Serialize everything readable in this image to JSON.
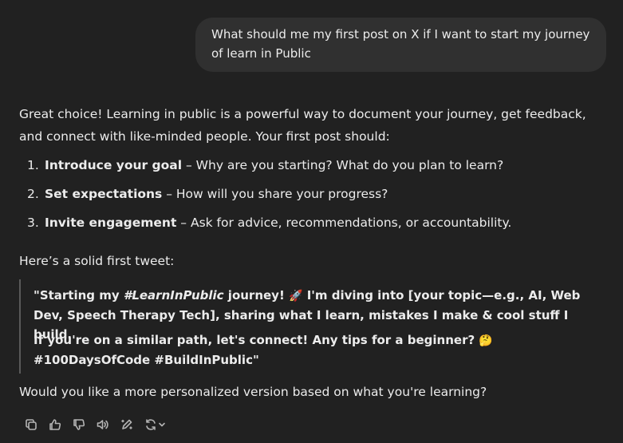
{
  "user_message": "What should me my first post on X if I want to start my journey of learn in Public",
  "response": {
    "intro": "Great choice! Learning in public is a powerful way to document your journey, get feedback, and connect with like-minded people. Your first post should:",
    "list": [
      {
        "num": "1.",
        "title": "Introduce your goal",
        "rest": " – Why are you starting? What do you plan to learn?"
      },
      {
        "num": "2.",
        "title": "Set expectations",
        "rest": " – How will you share your progress?"
      },
      {
        "num": "3.",
        "title": "Invite engagement",
        "rest": " – Ask for advice, recommendations, or accountability."
      }
    ],
    "tweet_intro": "Here’s a solid first tweet:",
    "quote": {
      "p1_a": "\"Starting my ",
      "p1_hashtag": "#LearnInPublic",
      "p1_b": " journey! ",
      "p1_emoji": "🚀",
      "p1_c": " I'm diving into [your topic—e.g., AI, Web Dev, Speech Therapy Tech], sharing what I learn, mistakes I make & cool stuff I build.",
      "p2_a": "If you're on a similar path, let's connect! Any tips for a beginner? ",
      "p2_emoji": "🤔",
      "p2_b": " #100DaysOfCode #BuildInPublic\""
    },
    "closing": "Would you like a more personalized version based on what you're learning?"
  },
  "actions": [
    {
      "name": "copy-icon"
    },
    {
      "name": "thumbs-up-icon"
    },
    {
      "name": "thumbs-down-icon"
    },
    {
      "name": "read-aloud-icon"
    },
    {
      "name": "edit-icon"
    },
    {
      "name": "regenerate-icon"
    }
  ]
}
